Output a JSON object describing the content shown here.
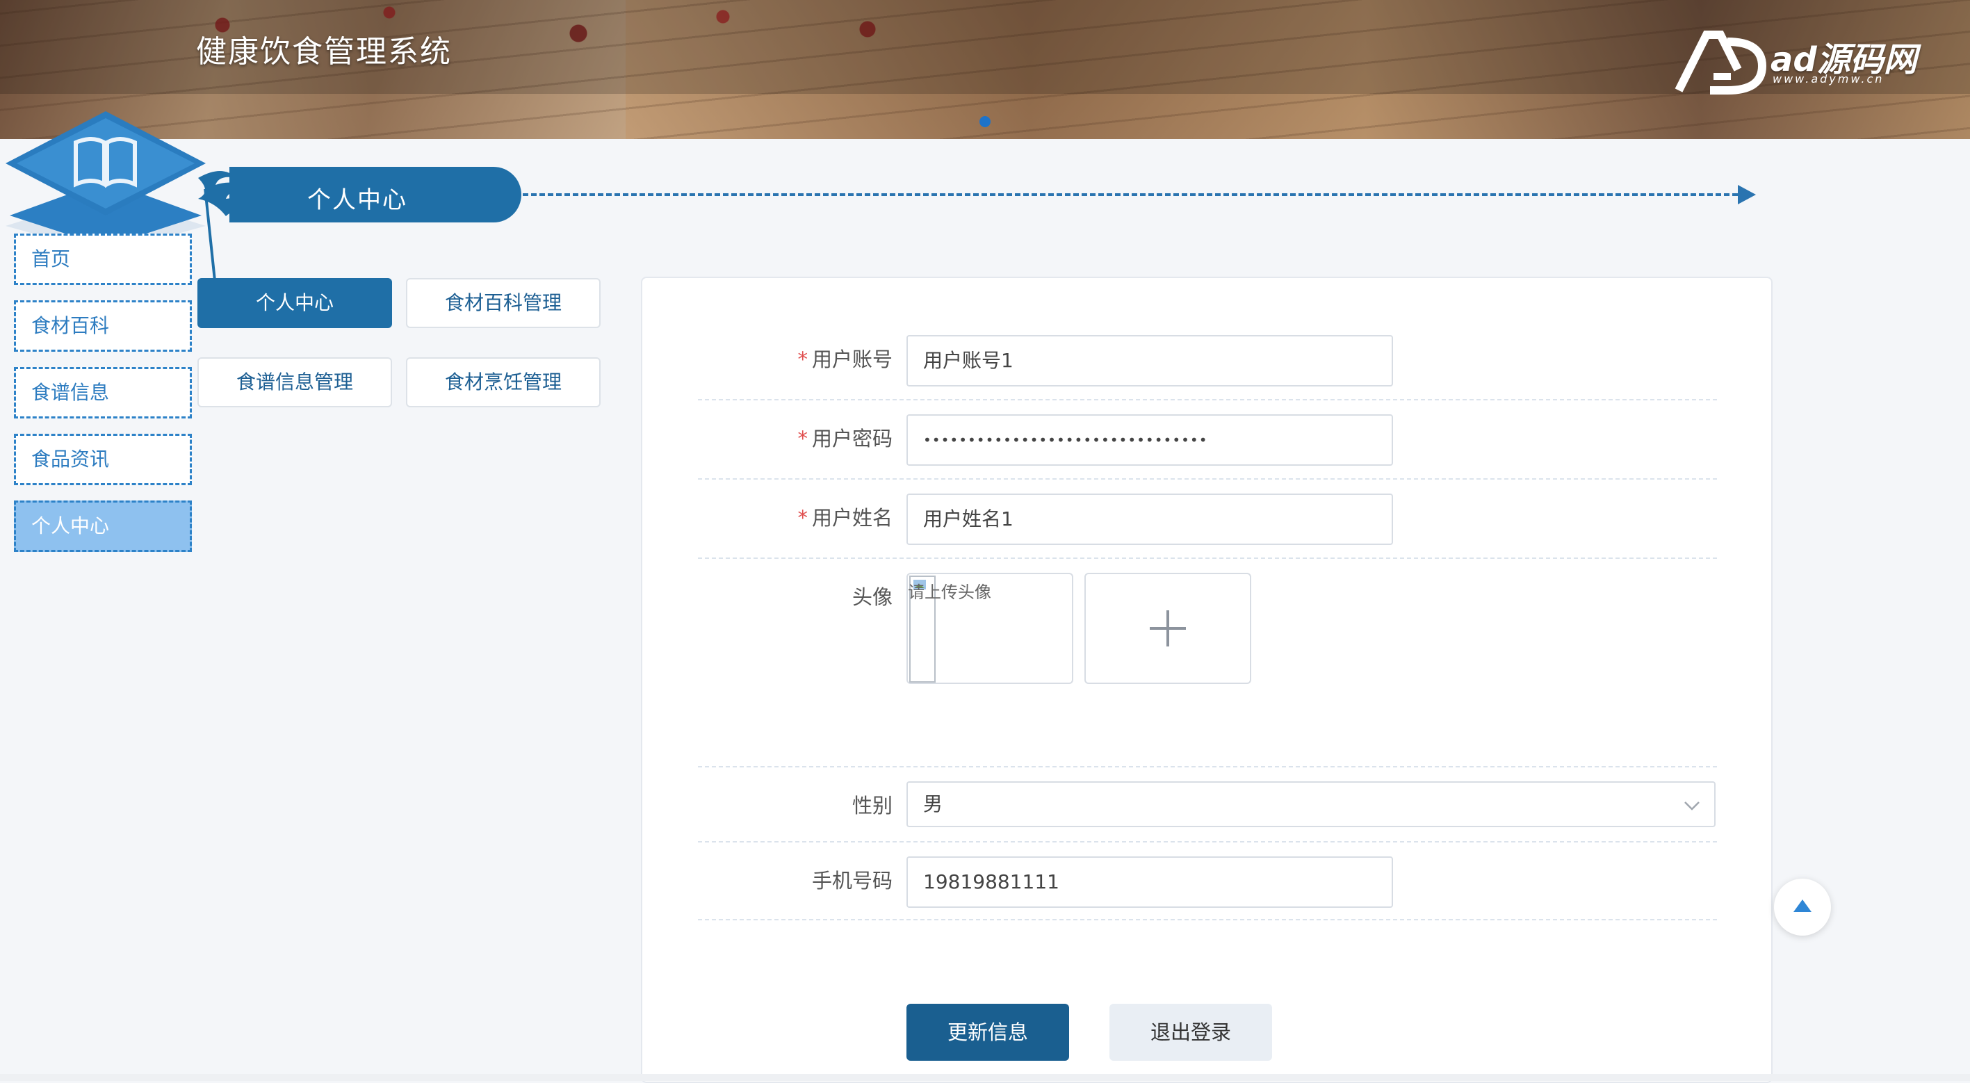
{
  "header": {
    "site_title": "健康饮食管理系统",
    "logo_text": "ad源码网",
    "logo_url": "www.adymw.cn"
  },
  "section": {
    "title": "个人中心"
  },
  "nav": {
    "items": [
      {
        "label": "首页"
      },
      {
        "label": "食材百科"
      },
      {
        "label": "食谱信息"
      },
      {
        "label": "食品资讯"
      },
      {
        "label": "个人中心",
        "active": true
      }
    ]
  },
  "submenu": {
    "items": [
      {
        "label": "个人中心",
        "active": true
      },
      {
        "label": "食材百科管理"
      },
      {
        "label": "食谱信息管理"
      },
      {
        "label": "食材烹饪管理"
      }
    ]
  },
  "form": {
    "account_label": "用户账号",
    "account_value": "用户账号1",
    "password_label": "用户密码",
    "password_value": "••••••••••••••••••••••••••••••••",
    "name_label": "用户姓名",
    "name_value": "用户姓名1",
    "avatar_label": "头像",
    "avatar_hint": "请上传头像",
    "gender_label": "性别",
    "gender_value": "男",
    "phone_label": "手机号码",
    "phone_value": "19819881111",
    "required_mark": "*",
    "update_button": "更新信息",
    "logout_button": "退出登录"
  },
  "colors": {
    "brand": "#1f6fa7",
    "nav_border": "#2d82c8",
    "nav_active": "#8ec1ef",
    "required": "#e04f4f"
  }
}
